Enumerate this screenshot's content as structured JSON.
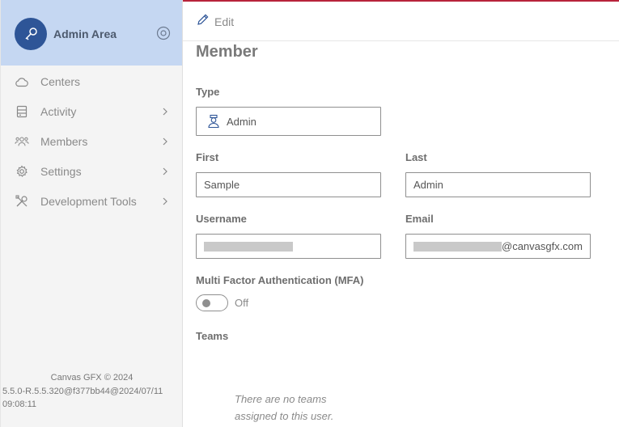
{
  "sidebar": {
    "header_title": "Admin Area",
    "avatar_icon": "key-icon",
    "settings_icon": "settings-circle-icon",
    "items": [
      {
        "label": "Centers",
        "icon": "cloud-icon",
        "has_children": false
      },
      {
        "label": "Activity",
        "icon": "server-icon",
        "has_children": true
      },
      {
        "label": "Members",
        "icon": "users-icon",
        "has_children": true
      },
      {
        "label": "Settings",
        "icon": "gear-icon",
        "has_children": true
      },
      {
        "label": "Development Tools",
        "icon": "tools-icon",
        "has_children": true
      }
    ],
    "footer": {
      "copyright": "Canvas GFX © 2024",
      "version": "5.5.0-R.5.5.320@f377bb44@2024/07/11 09:08:11"
    }
  },
  "topbar": {
    "edit_label": "Edit"
  },
  "form": {
    "title": "Member",
    "type_label": "Type",
    "type_value": "Admin",
    "first_label": "First",
    "first_value": "Sample",
    "last_label": "Last",
    "last_value": "Admin",
    "username_label": "Username",
    "email_label": "Email",
    "email_suffix": "@canvasgfx.com",
    "mfa_label": "Multi Factor Authentication (MFA)",
    "mfa_state": "Off",
    "teams_label": "Teams",
    "teams_empty": "There are no teams assigned to this user."
  },
  "colors": {
    "accent": "#2e5597",
    "header_bg": "#c5d7f2",
    "topbar_border": "#b8233b"
  }
}
